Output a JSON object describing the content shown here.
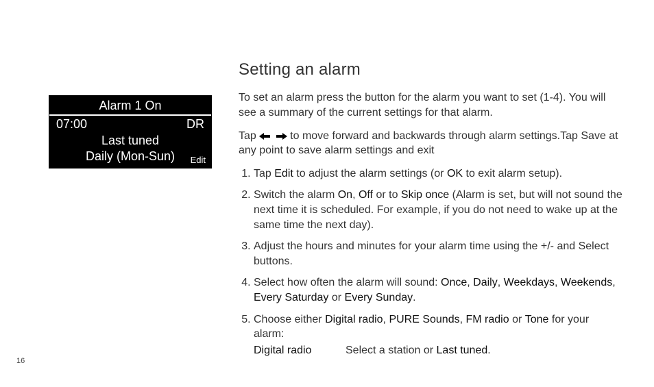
{
  "page_number": "16",
  "alarm_panel": {
    "title": "Alarm 1 On",
    "time": "07:00",
    "mode": "DR",
    "sub1": "Last tuned",
    "sub2": "Daily (Mon-Sun)",
    "edit": "Edit"
  },
  "heading": "Setting an alarm",
  "intro1": "To set an alarm press the button for the alarm you want to set (1-4). You will see a summary of the current settings for that alarm.",
  "intro2_a": "Tap",
  "intro2_b": "to move forward and backwards through alarm settings.Tap Save at any point to save alarm settings and exit",
  "steps": {
    "s1_a": "Tap ",
    "s1_edit": "Edit",
    "s1_b": " to adjust the alarm settings (or ",
    "s1_ok": "OK",
    "s1_c": " to exit alarm setup).",
    "s2_a": "Switch the alarm ",
    "s2_on": "On",
    "s2_sep1": ", ",
    "s2_off": "Off",
    "s2_sep2": " or to ",
    "s2_skip": "Skip once",
    "s2_b": " (Alarm is set, but will not sound the next time it is scheduled. For example, if you do not need to wake up at the same time the next day).",
    "s3": "Adjust the hours and minutes for your alarm time using the +/- and Select buttons.",
    "s4_a": "Select how often the alarm will sound: ",
    "s4_once": "Once",
    "s4_sep1": ", ",
    "s4_daily": "Daily",
    "s4_sep2": ", ",
    "s4_wkd": "Weekdays",
    "s4_sep3": ", ",
    "s4_wke": "Weekends",
    "s4_sep4": ", ",
    "s4_sat": "Every Saturday",
    "s4_sep5": " or ",
    "s4_sun": "Every Sunday",
    "s4_end": ".",
    "s5_a": "Choose either ",
    "s5_dr": "Digital radio",
    "s5_sep1": ", ",
    "s5_ps": "PURE Sounds",
    "s5_sep2": ", ",
    "s5_fm": "FM radio",
    "s5_sep3": " or ",
    "s5_tone": "Tone",
    "s5_b": " for your alarm:",
    "s5_row_label": "Digital radio",
    "s5_row_a": "Select a station or ",
    "s5_row_lt": "Last tuned",
    "s5_row_end": "."
  }
}
